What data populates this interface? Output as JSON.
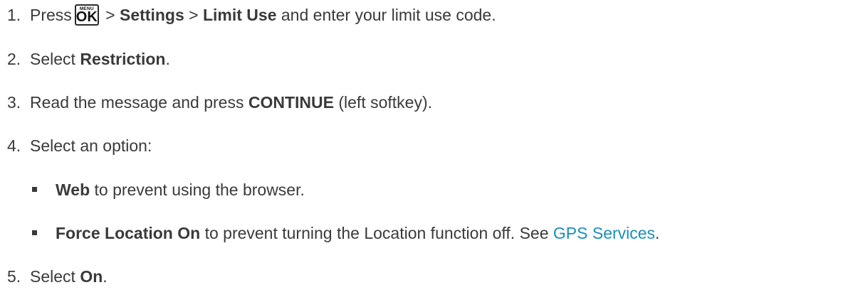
{
  "steps": [
    {
      "number": "1.",
      "pre": "Press",
      "key": {
        "top": "MENU",
        "main": "OK"
      },
      "sep1": " > ",
      "b1": "Settings",
      "sep2": " > ",
      "b2": "Limit Use",
      "post": " and enter your limit use code."
    },
    {
      "number": "2.",
      "pre": "Select ",
      "b1": "Restriction",
      "post": "."
    },
    {
      "number": "3.",
      "pre": "Read the message and press ",
      "b1": "CONTINUE",
      "post": " (left softkey)."
    },
    {
      "number": "4.",
      "text": "Select an option:"
    },
    {
      "number": "5.",
      "pre": "Select ",
      "b1": "On",
      "post": "."
    }
  ],
  "options": [
    {
      "b1": "Web",
      "post": " to prevent using the browser."
    },
    {
      "b1": "Force Location On",
      "post": " to prevent turning the Location function off. See ",
      "link": "GPS Services",
      "end": "."
    }
  ]
}
